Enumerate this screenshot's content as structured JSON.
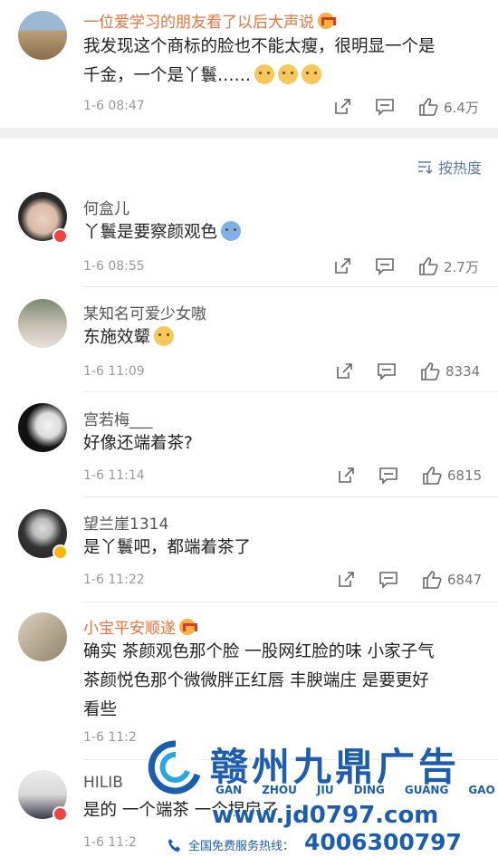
{
  "post": {
    "user": "一位爱学习的朋友看了以后大声说",
    "text_line1": "我发现这个商标的脸也不能太瘦，很明显一个是",
    "text_line2": "千金，一个是丫鬟……",
    "time": "1-6 08:47",
    "likes": "6.4万"
  },
  "sort": {
    "label": "按热度"
  },
  "comments": [
    {
      "user": "何盒儿",
      "text": "丫鬟是要察颜观色",
      "time": "1-6 08:55",
      "likes": "2.7万"
    },
    {
      "user": "某知名可爱少女嗷",
      "text": "东施效颦",
      "time": "1-6 11:09",
      "likes": "8334"
    },
    {
      "user": "宫若梅___",
      "text": "好像还端着茶?",
      "time": "1-6 11:14",
      "likes": "6815"
    },
    {
      "user": "望兰崖1314",
      "text": "是丫鬟吧，都端着茶了",
      "time": "1-6 11:22",
      "likes": "6847"
    },
    {
      "user": "小宝平安顺遂",
      "text_line1": "确实  茶颜观色那个脸  一股网红脸的味  小家子气",
      "text_line2": "茶颜悦色那个微微胖正红唇   丰腴端庄  是要更好",
      "text_line3": "看些",
      "time": "1-6 11:2"
    },
    {
      "user": "HILIB",
      "text": "是的  一个端茶  一个捏扇子",
      "time": "1-6 11:2"
    }
  ],
  "watermark": {
    "brand": "赣州九鼎广告",
    "pinyin": [
      "GAN",
      "ZHOU",
      "JIU",
      "DING",
      "GUANG",
      "GAO"
    ],
    "url": "www.jd0797.com",
    "hotline_label": "全国免费服务热线：",
    "phone": "4006300797"
  },
  "colors": {
    "vip_name": "#eb7340",
    "link_blue": "#5b7ca0",
    "watermark_blue": "#1d5db0"
  },
  "icons": [
    "share-icon",
    "comment-icon",
    "like-icon",
    "sort-icon",
    "crown-icon",
    "phone-icon"
  ]
}
